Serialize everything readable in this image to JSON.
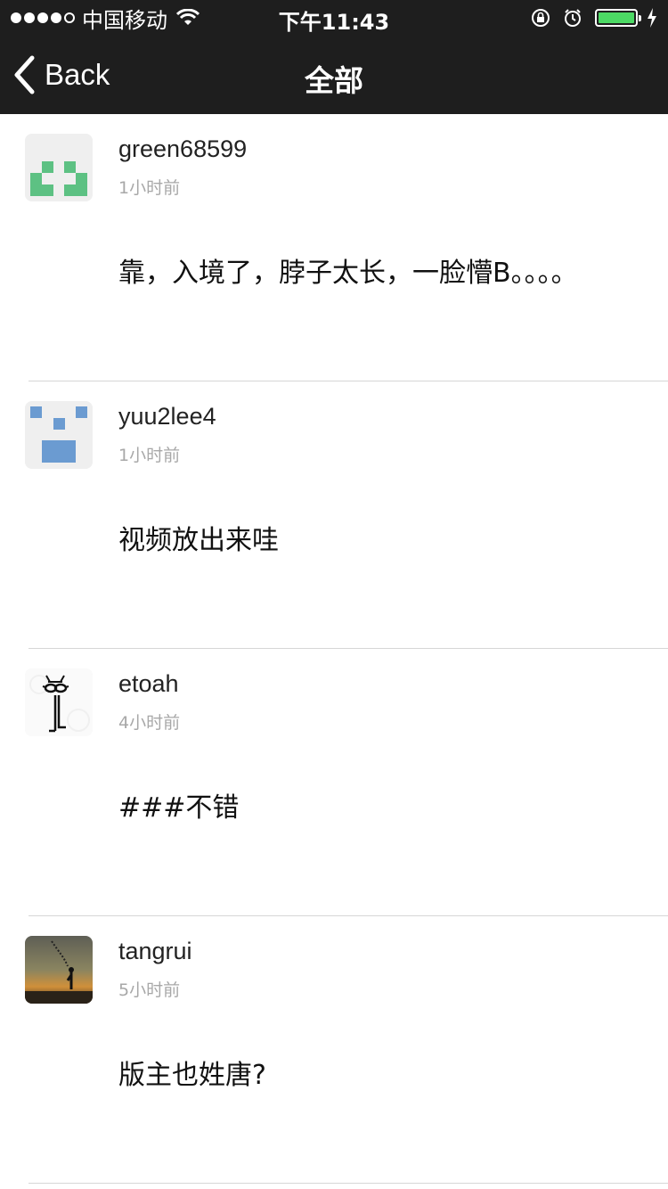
{
  "status_bar": {
    "carrier": "中国移动",
    "time": "下午11:43",
    "battery_color": "#4cd964"
  },
  "nav": {
    "back_label": "Back",
    "title": "全部"
  },
  "comments": [
    {
      "username": "green68599",
      "time_ago": "1小时前",
      "content": "靠，入境了，脖子太长，一脸懵B。。。。",
      "avatar": "green-identicon"
    },
    {
      "username": "yuu2lee4",
      "time_ago": "1小时前",
      "content": "视频放出来哇",
      "avatar": "blue-identicon"
    },
    {
      "username": "etoah",
      "time_ago": "4小时前",
      "content": "###不错",
      "avatar": "cat-glasses-drawing"
    },
    {
      "username": "tangrui",
      "time_ago": "5小时前",
      "content": "版主也姓唐?",
      "avatar": "sunset-photo"
    }
  ]
}
